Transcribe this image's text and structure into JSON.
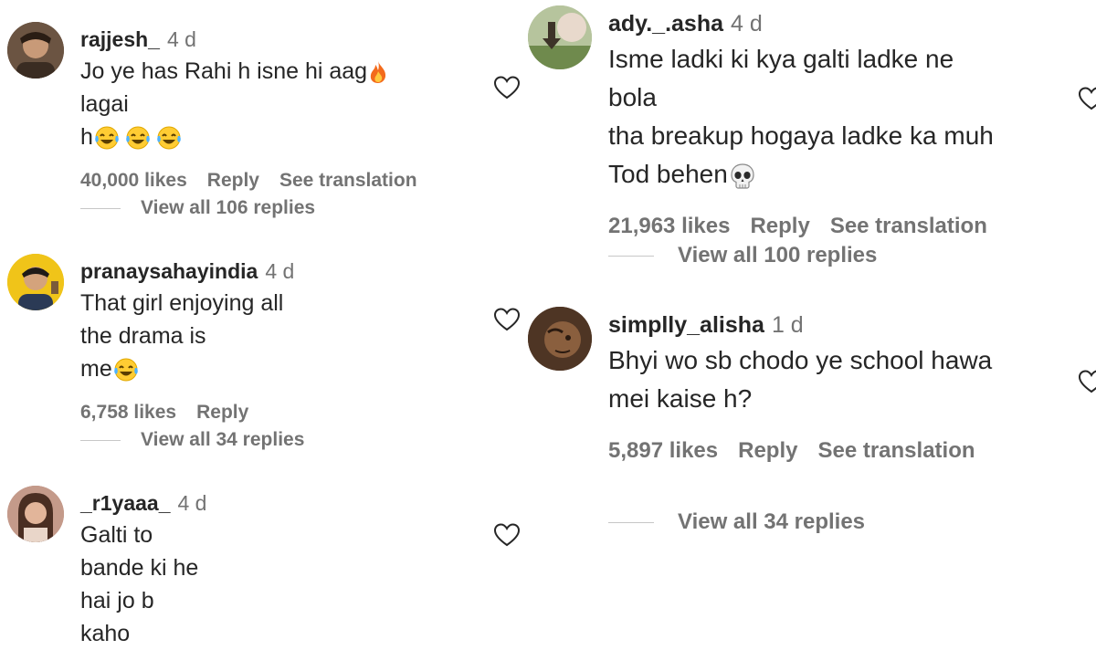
{
  "left_comments": [
    {
      "username": "rajjesh_",
      "time": "4 d",
      "text_parts": [
        "Jo ye has Rahi h isne hi aag",
        " lagai",
        "h"
      ],
      "text_emojis": [
        "fire-emoji",
        "tears-of-joy-emoji x3"
      ],
      "likes": "40,000 likes",
      "reply": "Reply",
      "translation": "See translation",
      "view_replies": "View all 106 replies"
    },
    {
      "username": "pranaysahayindia",
      "time": "4 d",
      "text_parts": [
        "That girl enjoying all the drama is",
        "me"
      ],
      "text_emojis": [
        "tears-of-joy-emoji"
      ],
      "likes": "6,758 likes",
      "reply": "Reply",
      "view_replies": "View all 34 replies"
    },
    {
      "username": "_r1yaaa_",
      "time": "4 d",
      "text_parts": [
        "Galti to bande ki he hai jo b kaho"
      ]
    }
  ],
  "right_comments": [
    {
      "username": "ady._.asha",
      "time": "4 d",
      "text_parts": [
        "Isme ladki ki kya galti ladke ne bola",
        "tha breakup hogaya ladke ka muh",
        "Tod behen"
      ],
      "text_emojis": [
        "skull-emoji"
      ],
      "likes": "21,963 likes",
      "reply": "Reply",
      "translation": "See translation",
      "view_replies": "View all 100 replies"
    },
    {
      "username": "simplly_alisha",
      "time": "1 d",
      "text_parts": [
        "Bhyi wo sb chodo ye school hawa",
        "mei kaise h?"
      ],
      "likes": "5,897 likes",
      "reply": "Reply",
      "translation": "See translation",
      "view_replies": "View all 34 replies"
    }
  ],
  "colors": {
    "primary_text": "#262626",
    "secondary_text": "#737373",
    "reply_line": "#c7c7c7"
  }
}
